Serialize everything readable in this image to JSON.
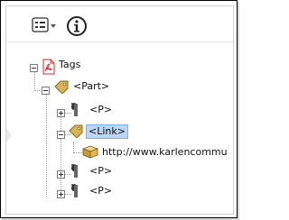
{
  "toolbar": {
    "options_icon": "list-options-icon",
    "info_icon": "info-icon"
  },
  "tree": {
    "root": {
      "label": "Tags",
      "icon": "pdf-tags-icon"
    },
    "part": {
      "label": "<Part>",
      "icon": "tag-icon"
    },
    "p1": {
      "label": "<P>",
      "icon": "paragraph-icon"
    },
    "link": {
      "label": "<Link>",
      "icon": "tag-icon"
    },
    "link_object": {
      "label": "http://www.karlencommu",
      "icon": "link-object-box-icon"
    },
    "p2": {
      "label": "<P>",
      "icon": "paragraph-icon"
    },
    "p3": {
      "label": "<P>",
      "icon": "paragraph-icon"
    }
  },
  "colors": {
    "selection": "#b9d7f5",
    "tag_icon": "#c9a23f",
    "pdf_icon": "#d62b2b"
  }
}
